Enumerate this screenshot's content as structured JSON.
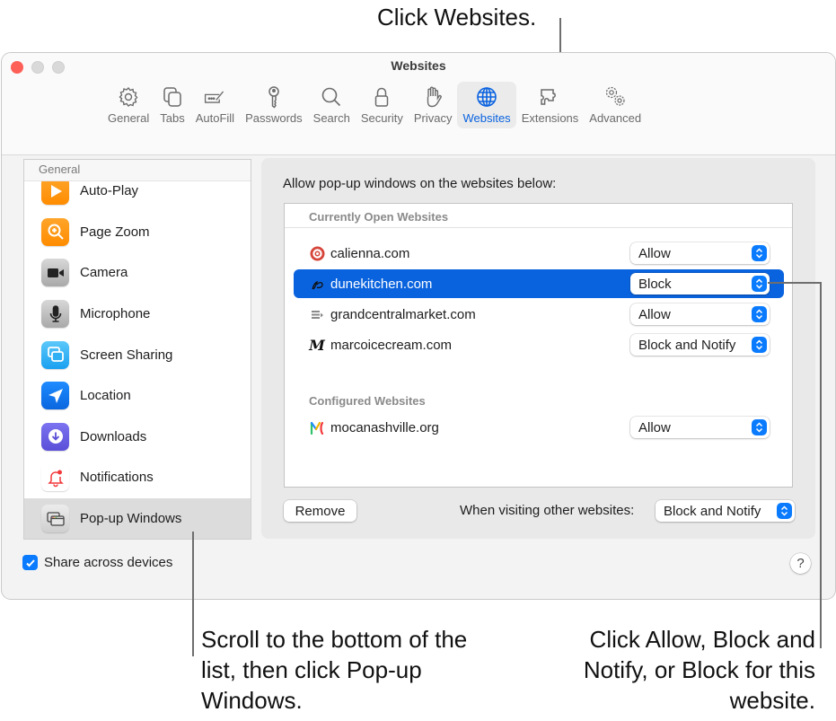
{
  "callouts": {
    "top": "Click Websites.",
    "left": "Scroll to the bottom of the list, then click Pop-up Windows.",
    "right": "Click Allow, Block and Notify, or Block for this website."
  },
  "window": {
    "title": "Websites",
    "accent_color": "#0a63de"
  },
  "toolbar": {
    "items": [
      {
        "label": "General",
        "icon": "gear-icon"
      },
      {
        "label": "Tabs",
        "icon": "tabs-icon"
      },
      {
        "label": "AutoFill",
        "icon": "autofill-icon"
      },
      {
        "label": "Passwords",
        "icon": "key-icon"
      },
      {
        "label": "Search",
        "icon": "search-icon"
      },
      {
        "label": "Security",
        "icon": "lock-icon"
      },
      {
        "label": "Privacy",
        "icon": "hand-icon"
      },
      {
        "label": "Websites",
        "icon": "globe-icon",
        "active": true
      },
      {
        "label": "Extensions",
        "icon": "puzzle-icon"
      },
      {
        "label": "Advanced",
        "icon": "gears-icon"
      }
    ]
  },
  "sidebar": {
    "header": "General",
    "items": [
      {
        "label": "Auto-Play",
        "icon": "play-icon"
      },
      {
        "label": "Page Zoom",
        "icon": "zoom-icon"
      },
      {
        "label": "Camera",
        "icon": "camera-icon"
      },
      {
        "label": "Microphone",
        "icon": "microphone-icon"
      },
      {
        "label": "Screen Sharing",
        "icon": "screen-sharing-icon"
      },
      {
        "label": "Location",
        "icon": "location-icon"
      },
      {
        "label": "Downloads",
        "icon": "downloads-icon"
      },
      {
        "label": "Notifications",
        "icon": "notifications-icon"
      },
      {
        "label": "Pop-up Windows",
        "icon": "popup-windows-icon",
        "selected": true
      }
    ],
    "share_label": "Share across devices",
    "share_checked": true
  },
  "main": {
    "heading": "Allow pop-up windows on the websites below:",
    "open_section": "Currently Open Websites",
    "open_sites": [
      {
        "name": "calienna.com",
        "value": "Allow"
      },
      {
        "name": "dunekitchen.com",
        "value": "Block",
        "selected": true
      },
      {
        "name": "grandcentralmarket.com",
        "value": "Allow"
      },
      {
        "name": "marcoicecream.com",
        "value": "Block and Notify"
      }
    ],
    "configured_section": "Configured Websites",
    "configured_sites": [
      {
        "name": "mocanashville.org",
        "value": "Allow"
      }
    ],
    "remove_label": "Remove",
    "other_label": "When visiting other websites:",
    "other_value": "Block and Notify",
    "help_label": "?"
  }
}
